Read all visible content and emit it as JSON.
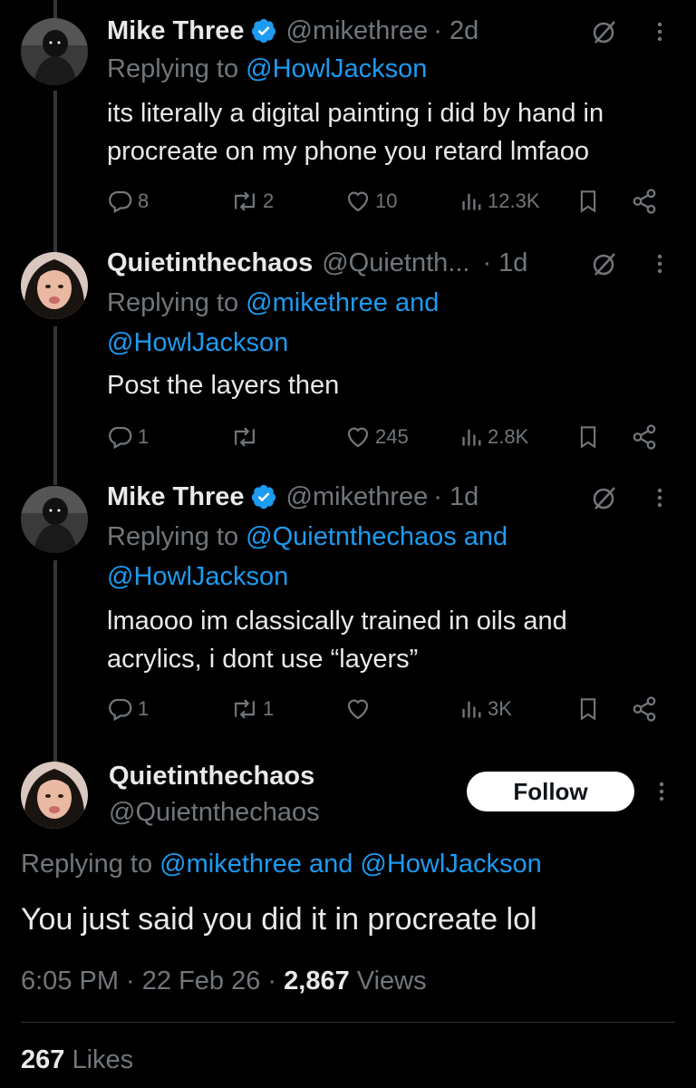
{
  "tweets": [
    {
      "name": "Mike Three",
      "verified": true,
      "handle": "@mikethree",
      "time": "· 2d",
      "reply_label": "Replying to",
      "reply_link": "@HowlJackson",
      "text1": "its literally a digital painting i did by hand in",
      "text2": "procreate on my phone you retard lmfaoo",
      "replies": "8",
      "reposts": "2",
      "likes": "10",
      "views": "12.3K"
    },
    {
      "name": "Quietinthechaos",
      "handle": "@Quietnth...",
      "time": "· 1d",
      "reply_label": "Replying to",
      "reply_link": "@mikethree and",
      "reply_link2": "@HowlJackson",
      "text1": "Post the layers then",
      "replies": "1",
      "reposts": "",
      "likes": "245",
      "views": "2.8K"
    },
    {
      "name": "Mike Three",
      "verified": true,
      "handle": "@mikethree",
      "time": "· 1d",
      "reply_label": "Replying to",
      "reply_link": "@Quietnthechaos and",
      "reply_link2": "@HowlJackson",
      "text1": "lmaooo im classically trained in oils and",
      "text2": "acrylics, i dont use “layers”",
      "replies": "1",
      "reposts": "1",
      "likes": "",
      "views": "3K"
    }
  ],
  "main": {
    "name": "Quietinthechaos",
    "handle": "@Quietnthechaos",
    "follow_label": "Follow",
    "reply_label": "Replying to",
    "reply_link": "@mikethree and @HowlJackson",
    "text": "You just said you did it in procreate lol",
    "timestamp": "6:05 PM · 22 Feb 26 ·",
    "views_count": "2,867",
    "views_label": "Views",
    "likes_count": "267",
    "likes_label": "Likes"
  },
  "colors": {
    "link": "#1d9bf0",
    "muted": "#71767b",
    "text": "#e7e9ea",
    "background": "#000000"
  },
  "icons": [
    "verified-badge-icon",
    "grok-icon",
    "more-icon",
    "reply-icon",
    "repost-icon",
    "like-icon",
    "views-icon",
    "bookmark-icon",
    "share-icon"
  ]
}
